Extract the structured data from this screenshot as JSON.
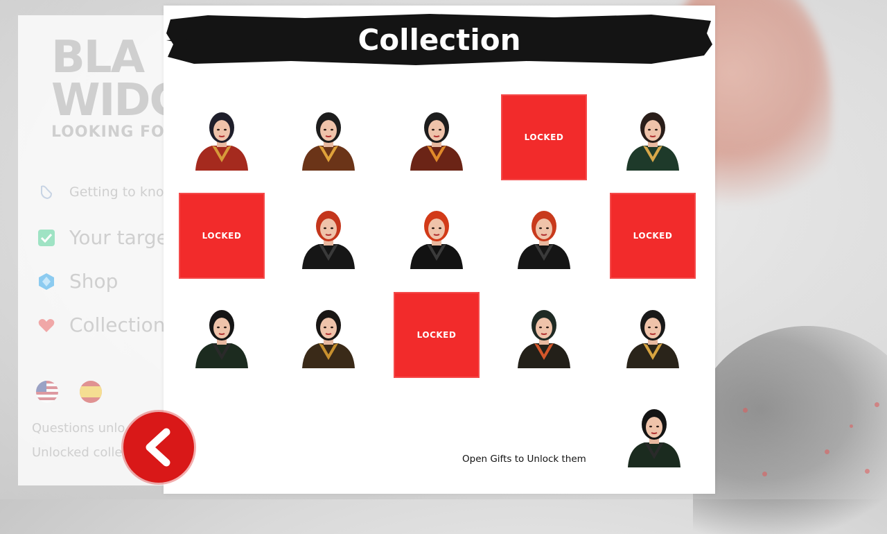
{
  "menu": {
    "logo": {
      "line1": "BLA",
      "line2": "WIDG",
      "line3": "LOOKING FO"
    },
    "items": [
      {
        "label": "Getting to kno",
        "icon": "hand-icon"
      },
      {
        "label": "Your targe",
        "icon": "checkbox-icon"
      },
      {
        "label": "Shop",
        "icon": "gem-icon"
      },
      {
        "label": "Collection",
        "icon": "heart-icon"
      }
    ],
    "flags": [
      "us-flag-icon",
      "spain-flag-icon"
    ],
    "stats": {
      "questions": "Questions unlo",
      "collection": "Unlocked colle"
    }
  },
  "modal": {
    "title": "Collection",
    "locked_label": "LOCKED",
    "grid": [
      {
        "state": "unlocked",
        "hair": "#1f1f2b",
        "outfit": "#a52a1e",
        "trim": "#d69a3a"
      },
      {
        "state": "unlocked",
        "hair": "#1d1d1d",
        "outfit": "#6b3418",
        "trim": "#e0a23a"
      },
      {
        "state": "unlocked",
        "hair": "#1d1d1d",
        "outfit": "#6b2416",
        "trim": "#e08a2a"
      },
      {
        "state": "locked"
      },
      {
        "state": "unlocked",
        "hair": "#2a1e1a",
        "outfit": "#1e3a2a",
        "trim": "#d8a84a"
      },
      {
        "state": "locked"
      },
      {
        "state": "unlocked",
        "hair": "#c4361c",
        "outfit": "#161616",
        "trim": "#3a3a3a"
      },
      {
        "state": "unlocked",
        "hair": "#d23a18",
        "outfit": "#121212",
        "trim": "#3a3a3a"
      },
      {
        "state": "unlocked",
        "hair": "#c83a1c",
        "outfit": "#151515",
        "trim": "#3a3a3a"
      },
      {
        "state": "locked"
      },
      {
        "state": "unlocked",
        "hair": "#151515",
        "outfit": "#1c2b1f",
        "trim": "#2a2a2a"
      },
      {
        "state": "unlocked",
        "hair": "#191614",
        "outfit": "#3a2a18",
        "trim": "#c8902e"
      },
      {
        "state": "locked"
      },
      {
        "state": "unlocked",
        "hair": "#1f2a24",
        "outfit": "#232019",
        "trim": "#d4562a"
      },
      {
        "state": "unlocked",
        "hair": "#191919",
        "outfit": "#2a241a",
        "trim": "#d8a440"
      }
    ],
    "preview": {
      "hair": "#141414",
      "outfit": "#1b2b1f",
      "trim": "#2a2a2a"
    },
    "hint": "Open Gifts to Unlock them"
  },
  "colors": {
    "accent": "#d91818",
    "locked": "#f22b2b",
    "banner": "#141414"
  }
}
